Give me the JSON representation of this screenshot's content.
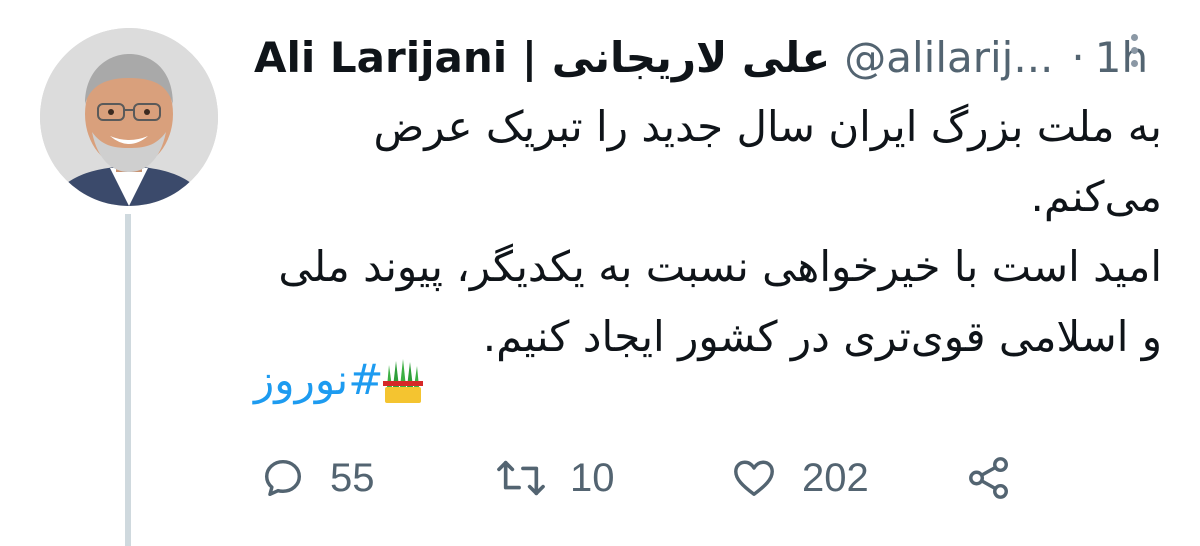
{
  "tweet": {
    "display_name": "Ali Larijani | علی لاریجانی",
    "handle": "@alilarij...",
    "separator": "·",
    "time": "1h",
    "text_lines": [
      "به ملت بزرگ ایران سال جدید را تبریک عرض",
      "می‌کنم.",
      "امید است با خیرخواهی نسبت به یکدیگر، پیوند ملی",
      "و اسلامی قوی‌تری در کشور ایجاد کنیم."
    ],
    "hashtag": "#نوروز",
    "emoji_icon": "sabzeh-icon"
  },
  "actions": {
    "reply_count": "55",
    "retweet_count": "10",
    "like_count": "202",
    "share_icon": "share-icon"
  },
  "colors": {
    "link": "#1d9bf0",
    "muted": "#536471",
    "text": "#0f1419",
    "thread_line": "#cfd9de"
  }
}
